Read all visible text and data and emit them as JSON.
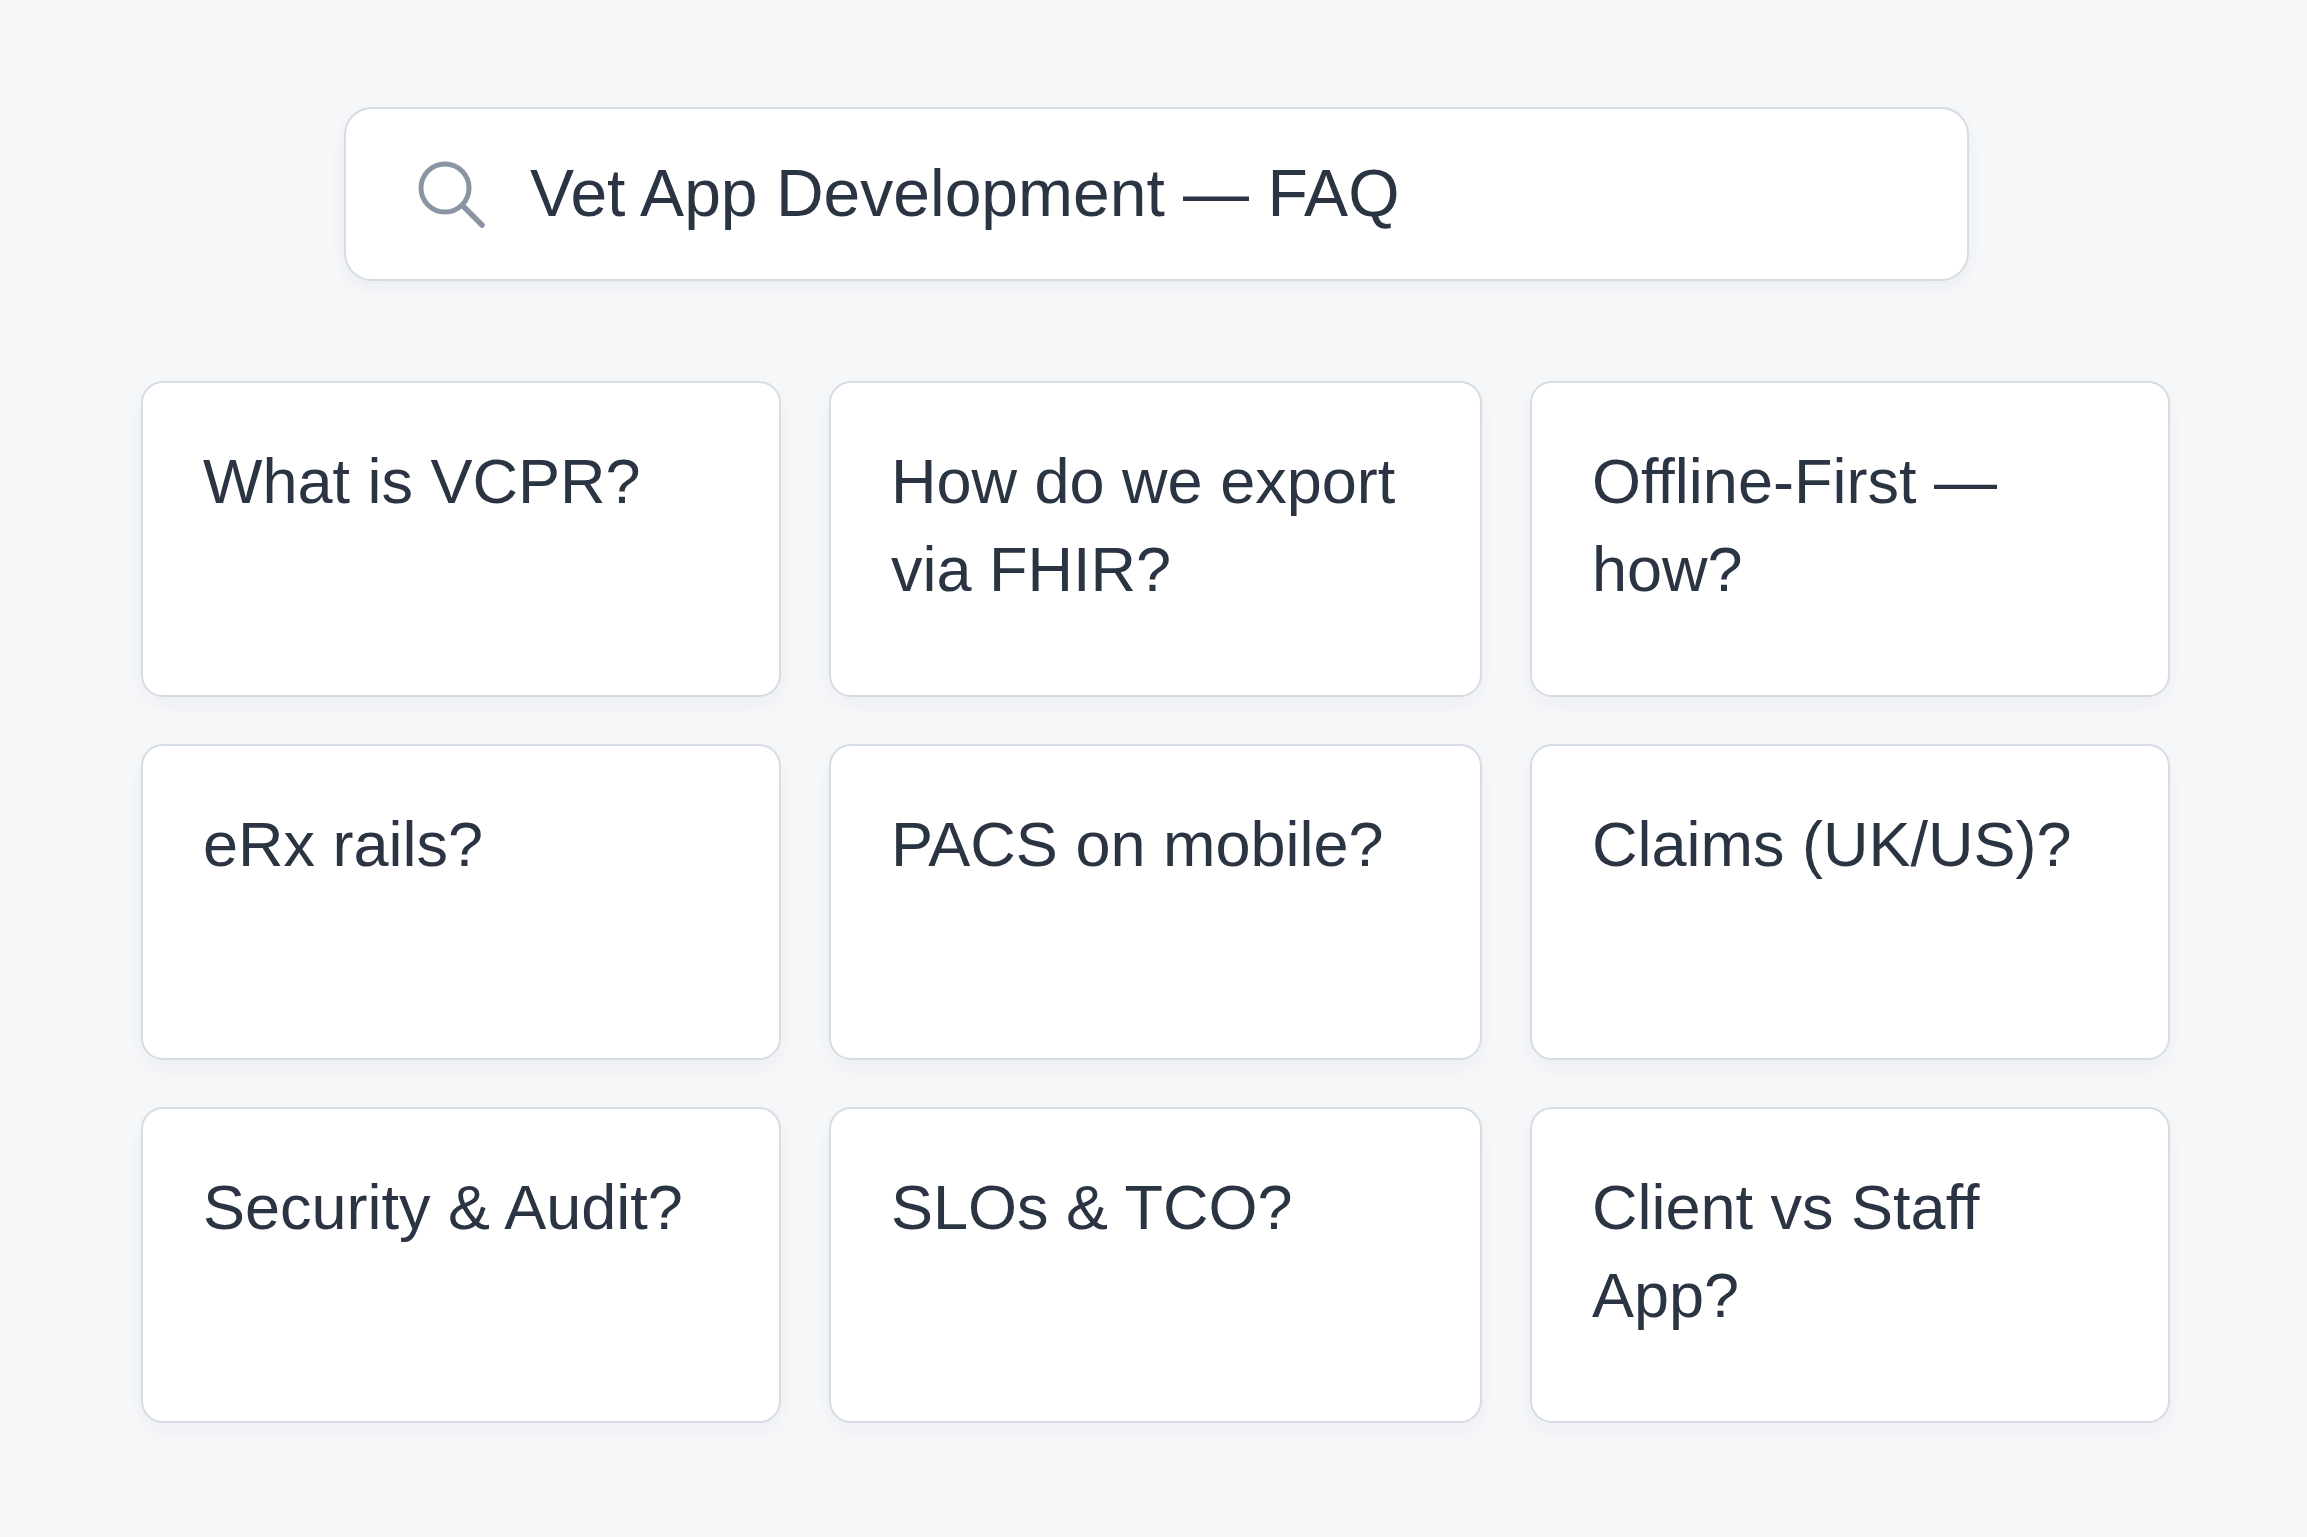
{
  "search": {
    "value": "Vet App Development — FAQ"
  },
  "cards": [
    {
      "title": "What is VCPR?"
    },
    {
      "title": "How do we export via FHIR?"
    },
    {
      "title": "Offline-First — how?"
    },
    {
      "title": "eRx rails?"
    },
    {
      "title": "PACS on mobile?"
    },
    {
      "title": "Claims (UK/US)?"
    },
    {
      "title": "Security & Audit?"
    },
    {
      "title": "SLOs & TCO?"
    },
    {
      "title": "Client vs Staff App?"
    }
  ]
}
